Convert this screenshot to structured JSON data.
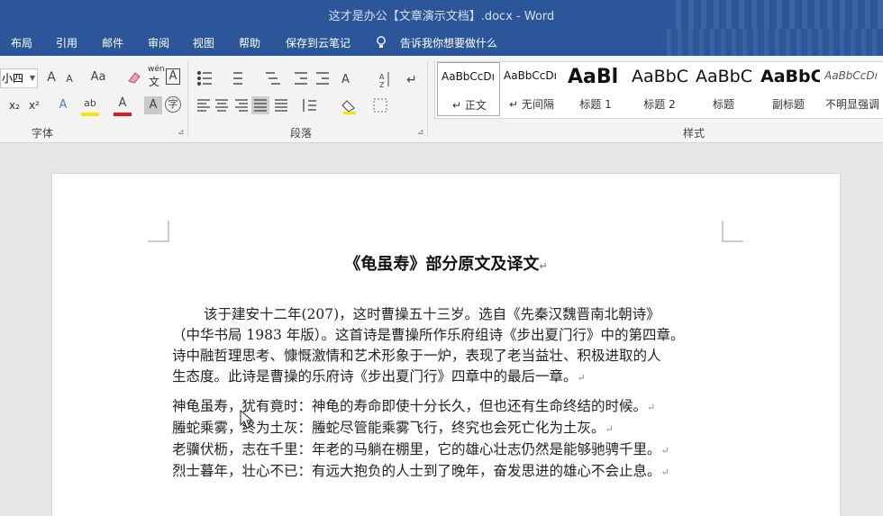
{
  "window": {
    "title": "这才是办公【文章演示文档】.docx  -  Word"
  },
  "menu": {
    "tabs": [
      "布局",
      "引用",
      "邮件",
      "审阅",
      "视图",
      "帮助",
      "保存到云笔记"
    ],
    "tell_me": "告诉我你想要做什么"
  },
  "font_group": {
    "size": "小四",
    "label": "字体",
    "buttons": {
      "grow": "A",
      "shrink": "A",
      "case": "Aa",
      "clear": "",
      "pinyin_top": "wén",
      "pinyin_bottom": "文",
      "border": "A",
      "subscript": "x₂",
      "superscript": "x²",
      "effects": "A",
      "highlight": "ab",
      "color": "A",
      "shade": "A",
      "enclose": "字"
    }
  },
  "paragraph_group": {
    "label": "段落"
  },
  "styles_group": {
    "label": "样式",
    "items": [
      {
        "preview": "AaBbCcDı",
        "name": "正文"
      },
      {
        "preview": "AaBbCcDı",
        "name": "无间隔"
      },
      {
        "preview": "AaBl",
        "name": "标题 1"
      },
      {
        "preview": "AaBbC",
        "name": "标题 2"
      },
      {
        "preview": "AaBbC",
        "name": "标题"
      },
      {
        "preview": "AaBbC",
        "name": "副标题"
      },
      {
        "preview": "AaBbCcDı",
        "name": "不明显强调"
      }
    ]
  },
  "document": {
    "title": "《龟虽寿》部分原文及译文",
    "intro_lines": [
      "该于建安十二年(207)，这时曹操五十三岁。选自《先秦汉魏晋南北朝诗》",
      "（中华书局 1983 年版）。这首诗是曹操所作乐府组诗《步出夏门行》中的第四章。",
      "诗中融哲理思考、慷慨激情和艺术形象于一炉，表现了老当益壮、积极进取的人",
      "生态度。此诗是曹操的乐府诗《步出夏门行》四章中的最后一章。"
    ],
    "verse_lines": [
      "神龟虽寿，犹有竟时：神龟的寿命即使十分长久，但也还有生命终结的时候。",
      "螣蛇乘雾，终为土灰：螣蛇尽管能乘雾飞行，终究也会死亡化为土灰。",
      "老骥伏枥，志在千里：年老的马躺在棚里，它的雄心壮志仍然是能够驰骋千里。",
      "烈士暮年，壮心不已：有远大抱负的人士到了晚年，奋发思进的雄心不会止息。"
    ],
    "para_mark": "↵"
  }
}
